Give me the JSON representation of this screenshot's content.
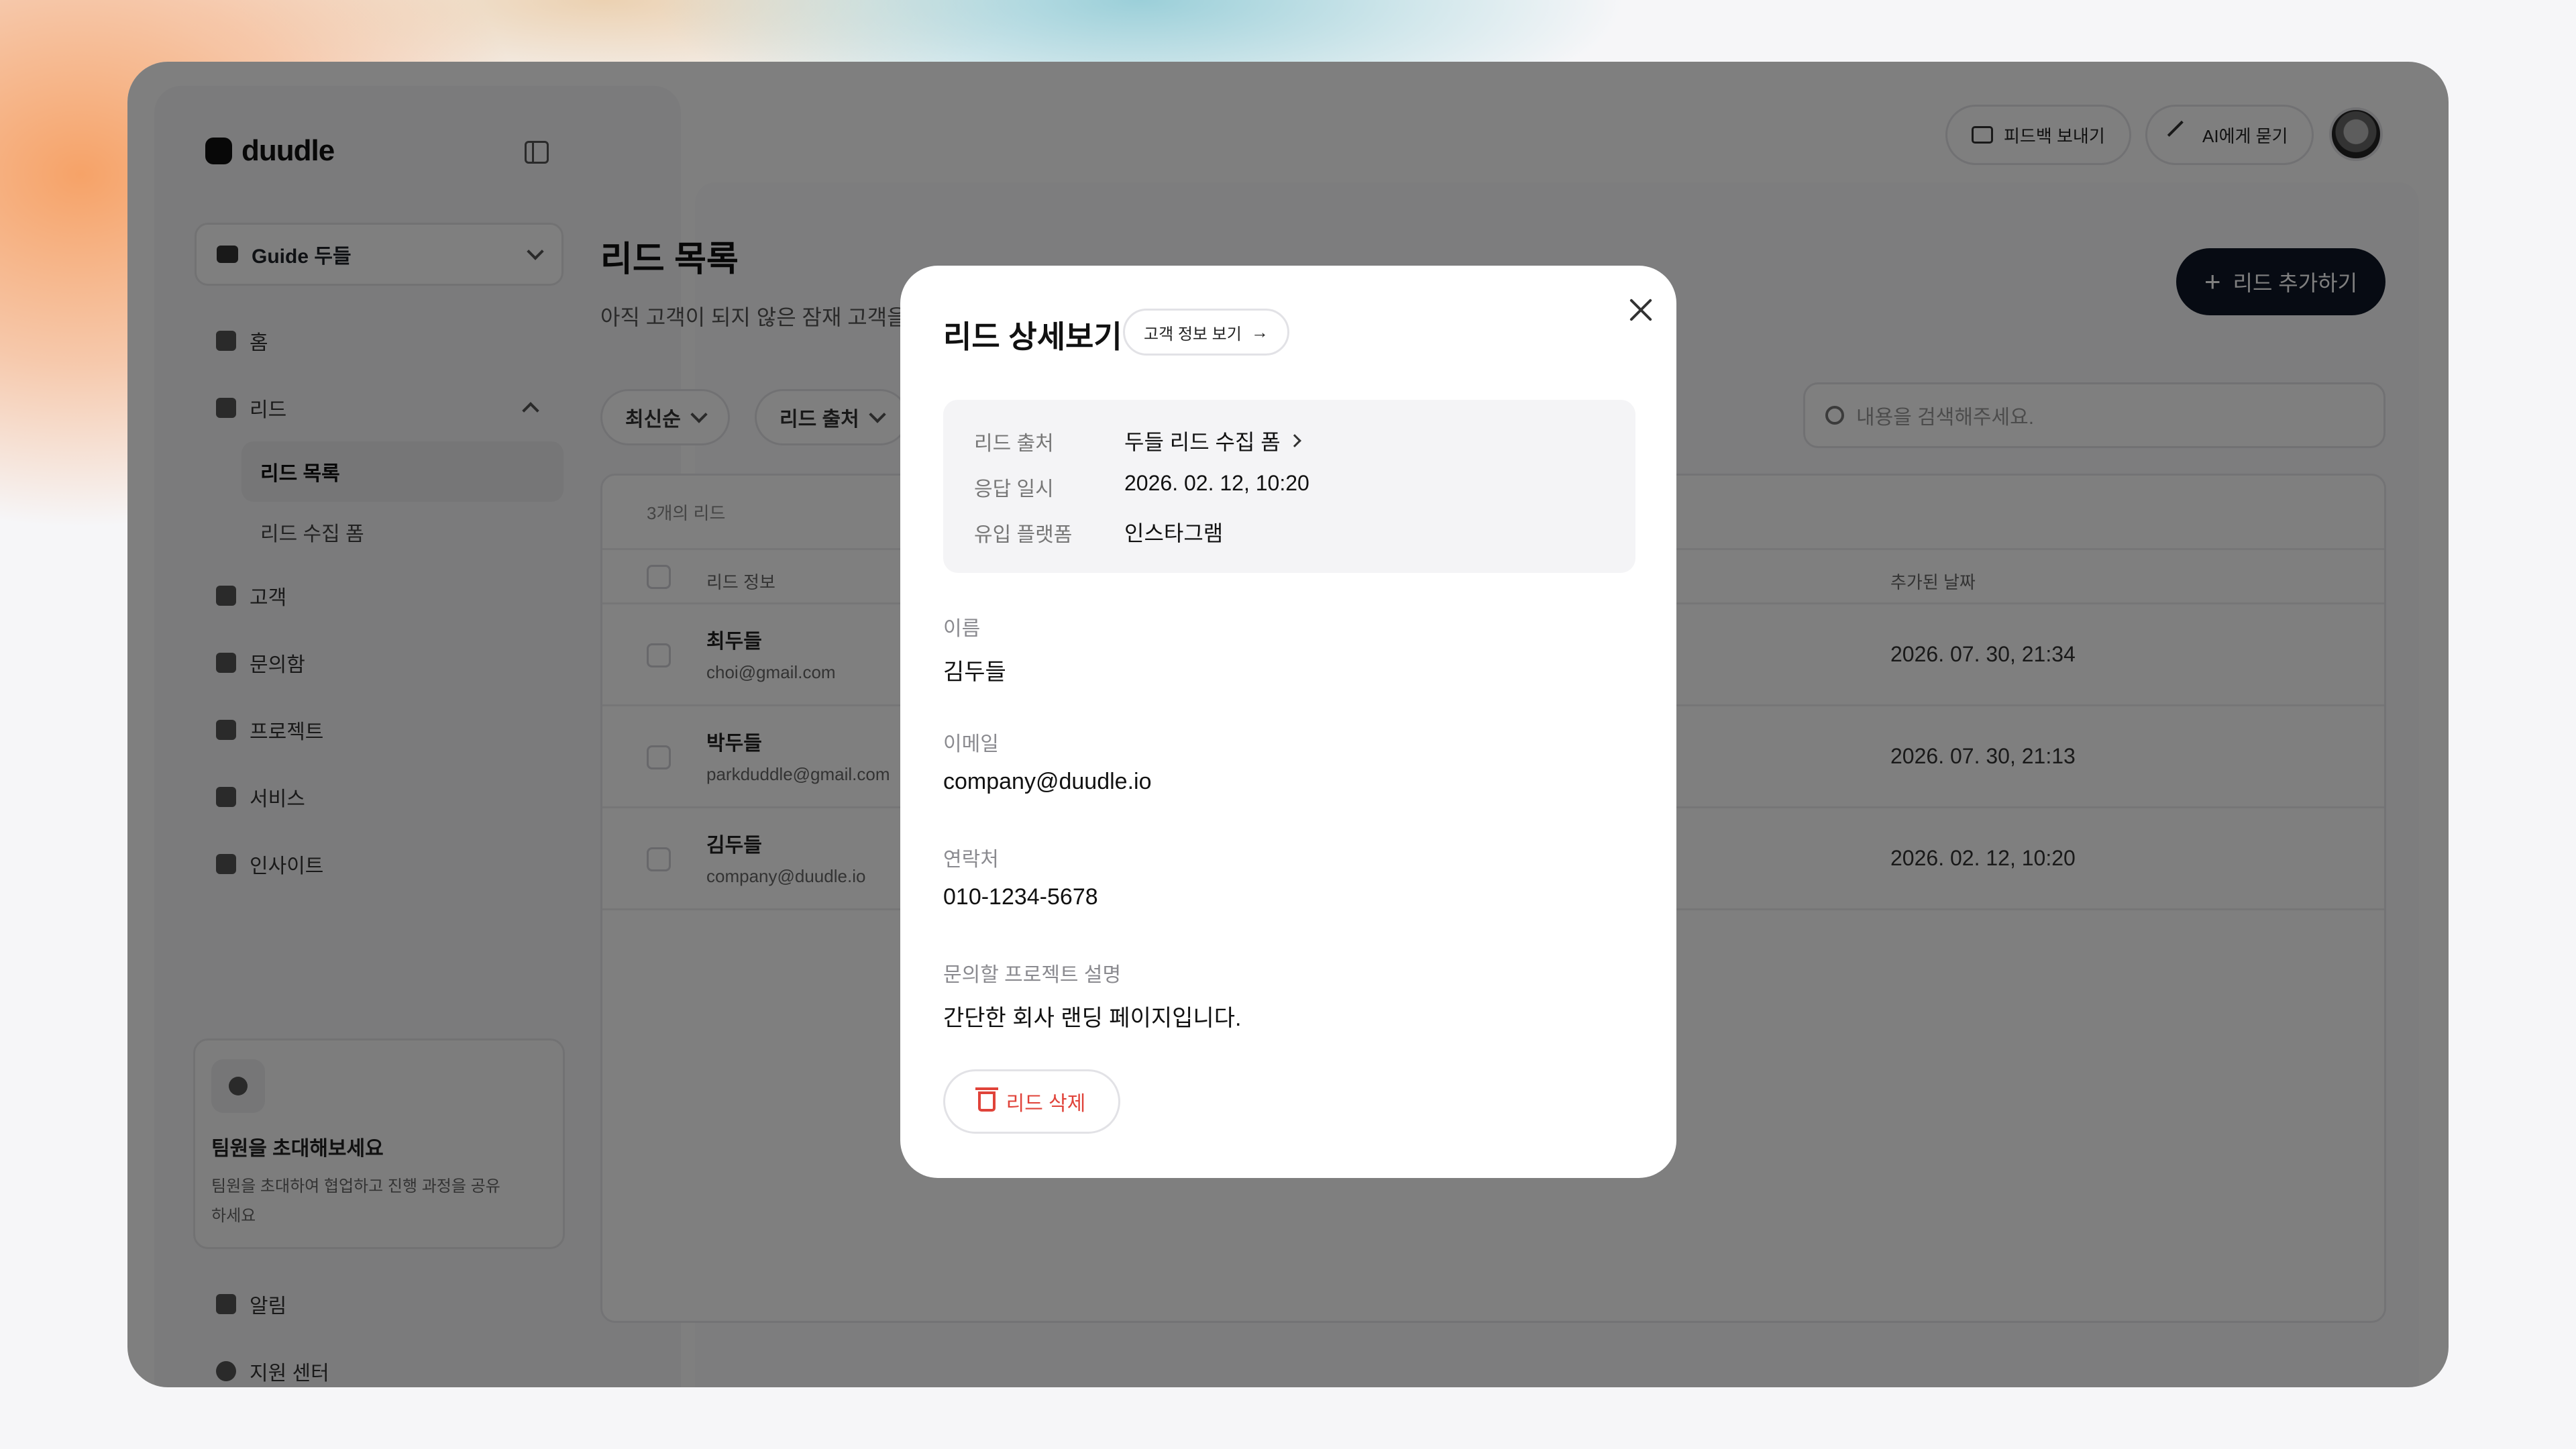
{
  "brand": {
    "name": "duudle"
  },
  "workspace": {
    "label": "Guide 두들"
  },
  "nav": {
    "home": "홈",
    "leads": "리드",
    "lead_list": "리드 목록",
    "lead_form": "리드 수집 폼",
    "customers": "고객",
    "inbox": "문의함",
    "projects": "프로젝트",
    "services": "서비스",
    "insights": "인사이트",
    "alerts": "알림",
    "support": "지원 센터"
  },
  "invite": {
    "title": "팀원을 초대해보세요",
    "desc": "팀원을 초대하여 협업하고 진행 과정을 공유하세요"
  },
  "topbar": {
    "feedback": "피드백 보내기",
    "ask_ai": "AI에게 묻기"
  },
  "page": {
    "title": "리드 목록",
    "subtitle": "아직 고객이 되지 않은 잠재 고객을",
    "add_button": "리드 추가하기"
  },
  "filters": {
    "sort": "최신순",
    "source": "리드 출처"
  },
  "search": {
    "placeholder": "내용을 검색해주세요."
  },
  "table": {
    "count": "3개의 리드",
    "col_info": "리드 정보",
    "col_date": "추가된 날짜",
    "rows": [
      {
        "name": "최두들",
        "email": "choi@gmail.com",
        "date": "2026. 07. 30, 21:34"
      },
      {
        "name": "박두들",
        "email": "parkduddle@gmail.com",
        "date": "2026. 07. 30, 21:13"
      },
      {
        "name": "김두들",
        "email": "company@duudle.io",
        "date": "2026. 02. 12, 10:20"
      }
    ]
  },
  "modal": {
    "title": "리드 상세보기",
    "customer_button": "고객 정보 보기",
    "info": {
      "source_label": "리드 출처",
      "source_value": "두들 리드 수집 폼",
      "response_label": "응답 일시",
      "response_value": "2026. 02. 12, 10:20",
      "platform_label": "유입 플랫폼",
      "platform_value": "인스타그램"
    },
    "name_label": "이름",
    "name_value": "김두들",
    "email_label": "이메일",
    "email_value": "company@duudle.io",
    "phone_label": "연락처",
    "phone_value": "010-1234-5678",
    "project_label": "문의할 프로젝트 설명",
    "project_value": "간단한 회사 랜딩 페이지입니다.",
    "delete_button": "리드 삭제"
  },
  "colors": {
    "primary_dark": "#0e1726",
    "danger": "#e0433a",
    "overlay": "rgba(0,0,0,0.5)"
  }
}
